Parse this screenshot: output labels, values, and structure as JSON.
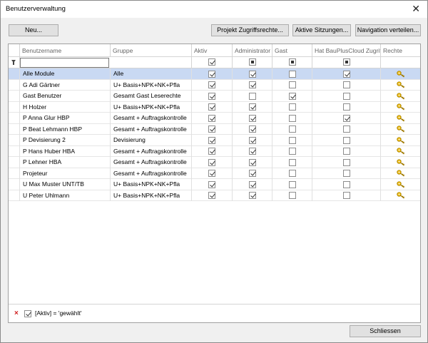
{
  "window": {
    "title": "Benutzerverwaltung"
  },
  "toolbar": {
    "new": "Neu...",
    "project_rights": "Projekt Zugriffsrechte...",
    "sessions": "Aktive Sitzungen...",
    "navigation": "Navigation verteilen..."
  },
  "columns": {
    "username": "Benutzername",
    "group": "Gruppe",
    "active": "Aktiv",
    "admin": "Administrator",
    "guest": "Gast",
    "cloud": "Hat BauPlusCloud Zugriff",
    "rights": "Rechte"
  },
  "filter_row": {
    "active": "checked",
    "admin": "indeterminate",
    "guest": "indeterminate",
    "cloud": "indeterminate"
  },
  "users": [
    {
      "name": "Alle Module",
      "group": "Alle",
      "active": true,
      "admin": true,
      "guest": false,
      "cloud": true,
      "selected": true
    },
    {
      "name": "G Adi Gärtner",
      "group": "U+ Basis+NPK+NK+Pfla",
      "active": true,
      "admin": true,
      "guest": false,
      "cloud": false
    },
    {
      "name": "Gast Benutzer",
      "group": "Gesamt Gast Leserechte",
      "active": true,
      "admin": false,
      "guest": true,
      "cloud": false
    },
    {
      "name": "H Holzer",
      "group": "U+ Basis+NPK+NK+Pfla",
      "active": true,
      "admin": true,
      "guest": false,
      "cloud": false
    },
    {
      "name": "P Anna Glur HBP",
      "group": "Gesamt + Auftragskontrolle",
      "active": true,
      "admin": true,
      "guest": false,
      "cloud": true
    },
    {
      "name": "P Beat Lehmann HBP",
      "group": "Gesamt + Auftragskontrolle",
      "active": true,
      "admin": true,
      "guest": false,
      "cloud": false
    },
    {
      "name": "P Devisierung 2",
      "group": "Devisierung",
      "active": true,
      "admin": true,
      "guest": false,
      "cloud": false
    },
    {
      "name": "P Hans Huber HBA",
      "group": "Gesamt + Auftragskontrolle",
      "active": true,
      "admin": true,
      "guest": false,
      "cloud": false
    },
    {
      "name": "P Lehner HBA",
      "group": "Gesamt + Auftragskontrolle",
      "active": true,
      "admin": true,
      "guest": false,
      "cloud": false
    },
    {
      "name": "Projeteur",
      "group": "Gesamt + Auftragskontrolle",
      "active": true,
      "admin": true,
      "guest": false,
      "cloud": false
    },
    {
      "name": "U Max Muster UNT/TB",
      "group": "U+ Basis+NPK+NK+Pfla",
      "active": true,
      "admin": true,
      "guest": false,
      "cloud": false
    },
    {
      "name": "U Peter Uhlmann",
      "group": "U+ Basis+NPK+NK+Pfla",
      "active": true,
      "admin": true,
      "guest": false,
      "cloud": false
    }
  ],
  "filter_status": {
    "clear_icon": "×",
    "text": "[Aktiv] = 'gewählt'"
  },
  "footer": {
    "close": "Schliessen"
  },
  "icons": {
    "rights": "key-icon",
    "filter": "funnel-icon"
  },
  "colors": {
    "selected_row": "#c9d9f3",
    "key": "#e8b400"
  }
}
